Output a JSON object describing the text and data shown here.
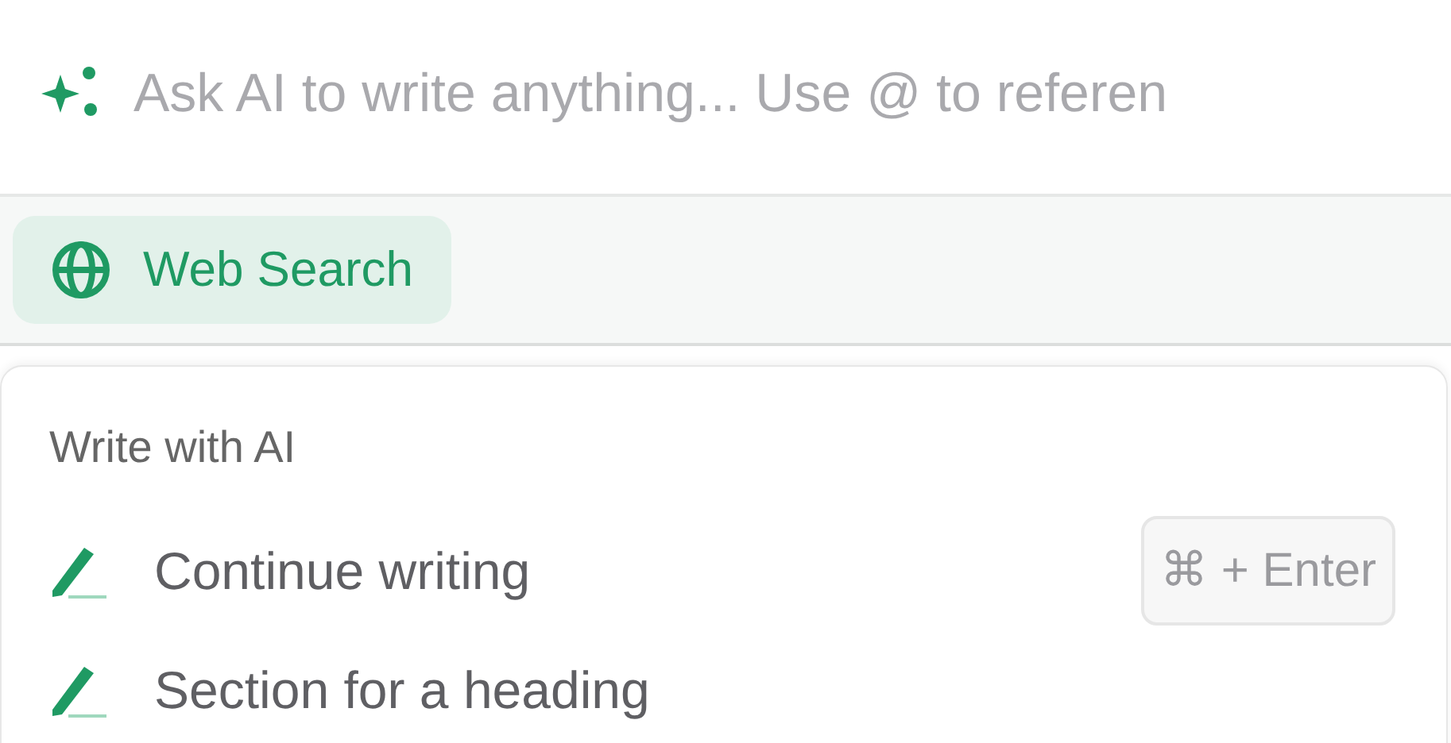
{
  "prompt": {
    "placeholder": "Ask AI to write anything... Use @ to referen"
  },
  "toolbar": {
    "chips": [
      {
        "label": "Web Search",
        "on": true
      }
    ]
  },
  "menu": {
    "heading": "Write with AI",
    "items": [
      {
        "label": "Continue writing",
        "shortcut": "⌘ + Enter"
      },
      {
        "label": "Section for a heading"
      }
    ]
  }
}
